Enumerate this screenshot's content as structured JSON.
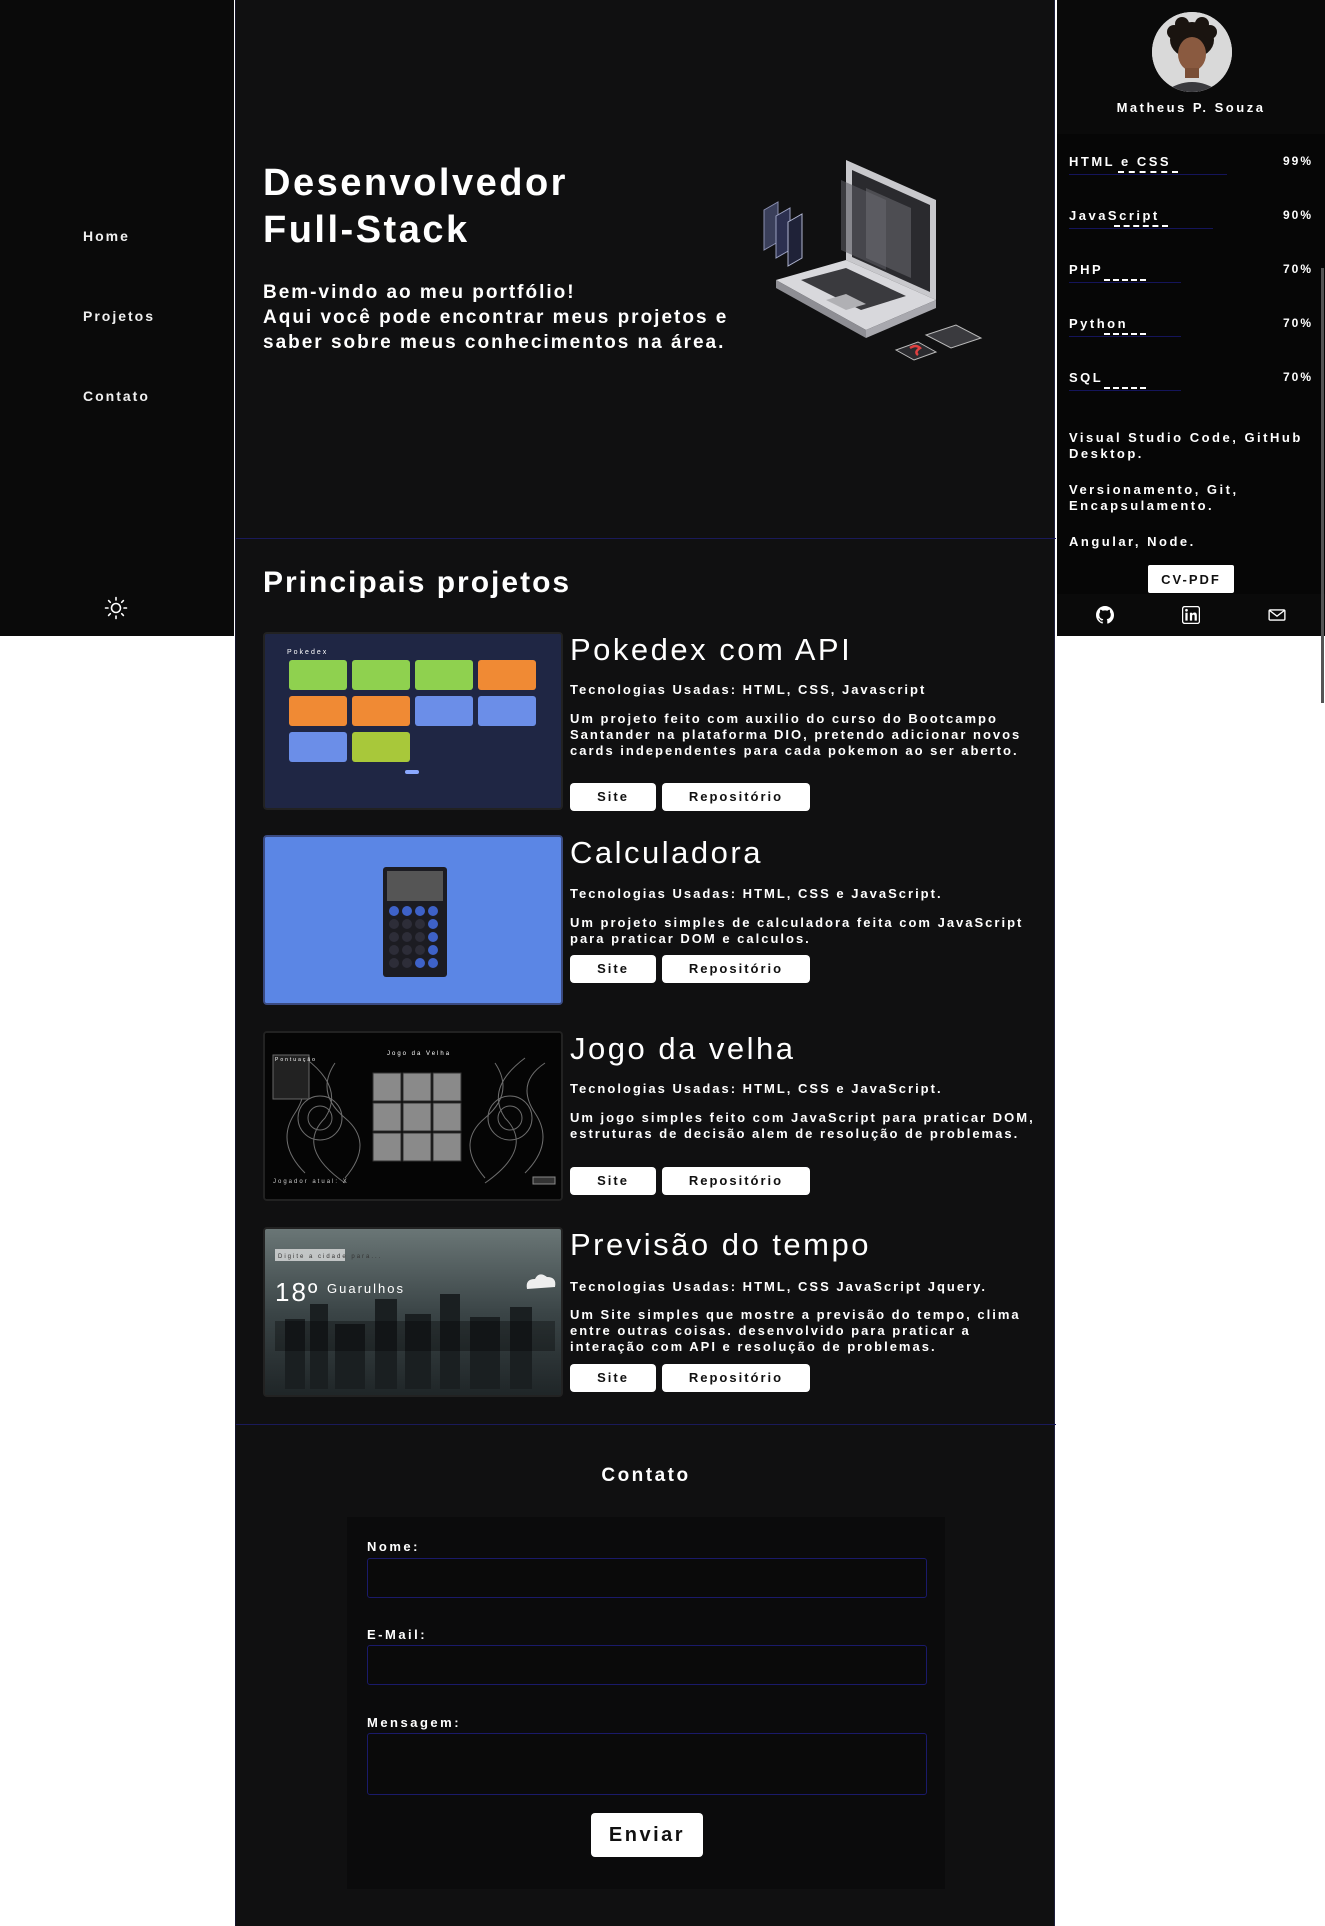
{
  "nav": {
    "home": "Home",
    "projetos": "Projetos",
    "contato": "Contato",
    "theme_icon": "sun-icon"
  },
  "hero": {
    "title_line1": "Desenvolvedor",
    "title_line2": "Full-Stack",
    "text_line1": "Bem-vindo ao meu portfólio!",
    "text_line2": "Aqui você pode encontrar meus projetos e saber sobre meus conhecimentos na área."
  },
  "projects": {
    "section_title": "Principais projetos",
    "items": [
      {
        "title": "Pokedex com API",
        "tech": "Tecnologias Usadas: HTML, CSS, Javascript",
        "desc": "Um projeto feito com auxilio do curso do Bootcampo Santander na plataforma DIO, pretendo adicionar novos cards independentes para cada pokemon ao ser aberto.",
        "site": "Site",
        "repo": "Repositório",
        "thumb_title": "Pokedex"
      },
      {
        "title": "Calculadora",
        "tech": "Tecnologias Usadas: HTML, CSS e JavaScript.",
        "desc": "Um projeto simples de calculadora feita com JavaScript para praticar DOM e calculos.",
        "site": "Site",
        "repo": "Repositório"
      },
      {
        "title": "Jogo da velha",
        "tech": "Tecnologias Usadas: HTML, CSS e JavaScript.",
        "desc": "Um jogo simples feito com JavaScript para praticar DOM, estruturas de decisão alem de resolução de problemas.",
        "site": "Site",
        "repo": "Repositório",
        "thumb_title": "Jogo da Velha",
        "thumb_score": "Pontuação",
        "thumb_player": "Jogador atual: X"
      },
      {
        "title": "Previsão do tempo",
        "tech": "Tecnologias Usadas: HTML, CSS JavaScript Jquery.",
        "desc": "Um Site simples que mostre a previsão do tempo, clima entre outras coisas. desenvolvido para praticar a interação com API e resolução de problemas.",
        "site": "Site",
        "repo": "Repositório",
        "thumb_temp": "18º",
        "thumb_city": "Guarulhos",
        "thumb_search": "Digite a cidade para..."
      }
    ]
  },
  "contact": {
    "title": "Contato",
    "name_label": "Nome:",
    "email_label": "E-Mail:",
    "message_label": "Mensagem:",
    "submit": "Enviar"
  },
  "profile": {
    "name": "Matheus P. Souza",
    "skills": [
      {
        "name": "HTML e CSS",
        "percent": "99%",
        "level": 0.99
      },
      {
        "name": "JavaScript",
        "percent": "90%",
        "level": 0.9
      },
      {
        "name": "PHP",
        "percent": "70%",
        "level": 0.7
      },
      {
        "name": "Python",
        "percent": "70%",
        "level": 0.7
      },
      {
        "name": "SQL",
        "percent": "70%",
        "level": 0.7
      }
    ],
    "tools_1": "Visual Studio Code, GitHub Desktop.",
    "tools_2": "Versionamento, Git, Encapsulamento.",
    "tools_3": "Angular, Node.",
    "cv_button": "CV-PDF",
    "social": [
      "github-icon",
      "linkedin-icon",
      "mail-icon"
    ]
  }
}
